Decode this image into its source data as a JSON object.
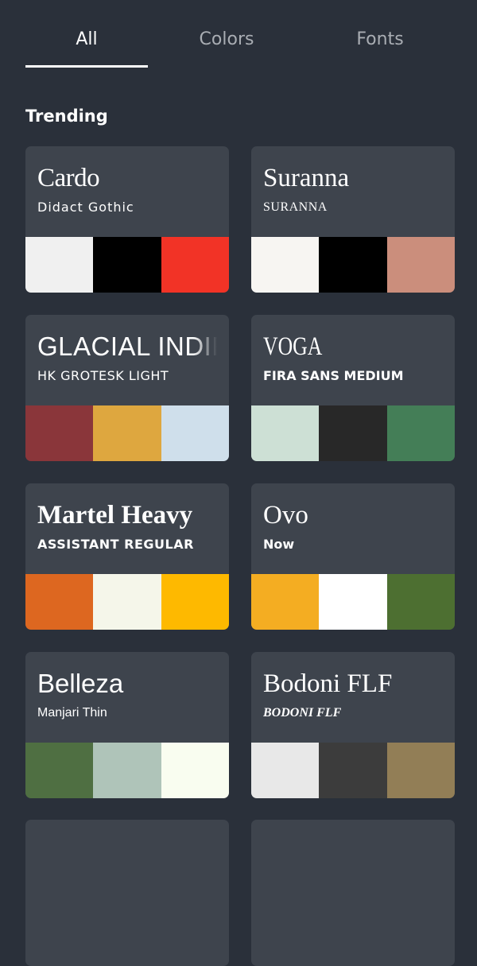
{
  "tabs": {
    "active": "All",
    "items": [
      {
        "label": "All"
      },
      {
        "label": "Colors"
      },
      {
        "label": "Fonts"
      }
    ]
  },
  "section": {
    "title": "Trending"
  },
  "cards": [
    {
      "title": "Cardo",
      "subtitle": "Didact Gothic",
      "colors": [
        "#f0f0f0",
        "#000000",
        "#f23326"
      ]
    },
    {
      "title": "Suranna",
      "subtitle": "SURANNA",
      "colors": [
        "#f7f5f2",
        "#000000",
        "#cb8e7c"
      ]
    },
    {
      "title": "GLACIAL INDIFFERENCE",
      "subtitle": "HK GROTESK LIGHT",
      "colors": [
        "#8a363a",
        "#dea73f",
        "#cfdfeb"
      ]
    },
    {
      "title": "VOGA",
      "subtitle": "FIRA SANS MEDIUM",
      "colors": [
        "#cde0d5",
        "#282828",
        "#447e57"
      ]
    },
    {
      "title": "Martel Heavy",
      "subtitle": "ASSISTANT REGULAR",
      "colors": [
        "#dd6720",
        "#f5f6ea",
        "#feb900"
      ]
    },
    {
      "title": "Ovo",
      "subtitle": "Now",
      "colors": [
        "#f4ad22",
        "#ffffff",
        "#4d6f31"
      ]
    },
    {
      "title": "Belleza",
      "subtitle": "Manjari Thin",
      "colors": [
        "#4f6f42",
        "#afc4b9",
        "#f9fdf0"
      ]
    },
    {
      "title": "Bodoni FLF",
      "subtitle": "BODONI FLF",
      "colors": [
        "#e8e8e8",
        "#3c3c3c",
        "#927e56"
      ]
    }
  ]
}
